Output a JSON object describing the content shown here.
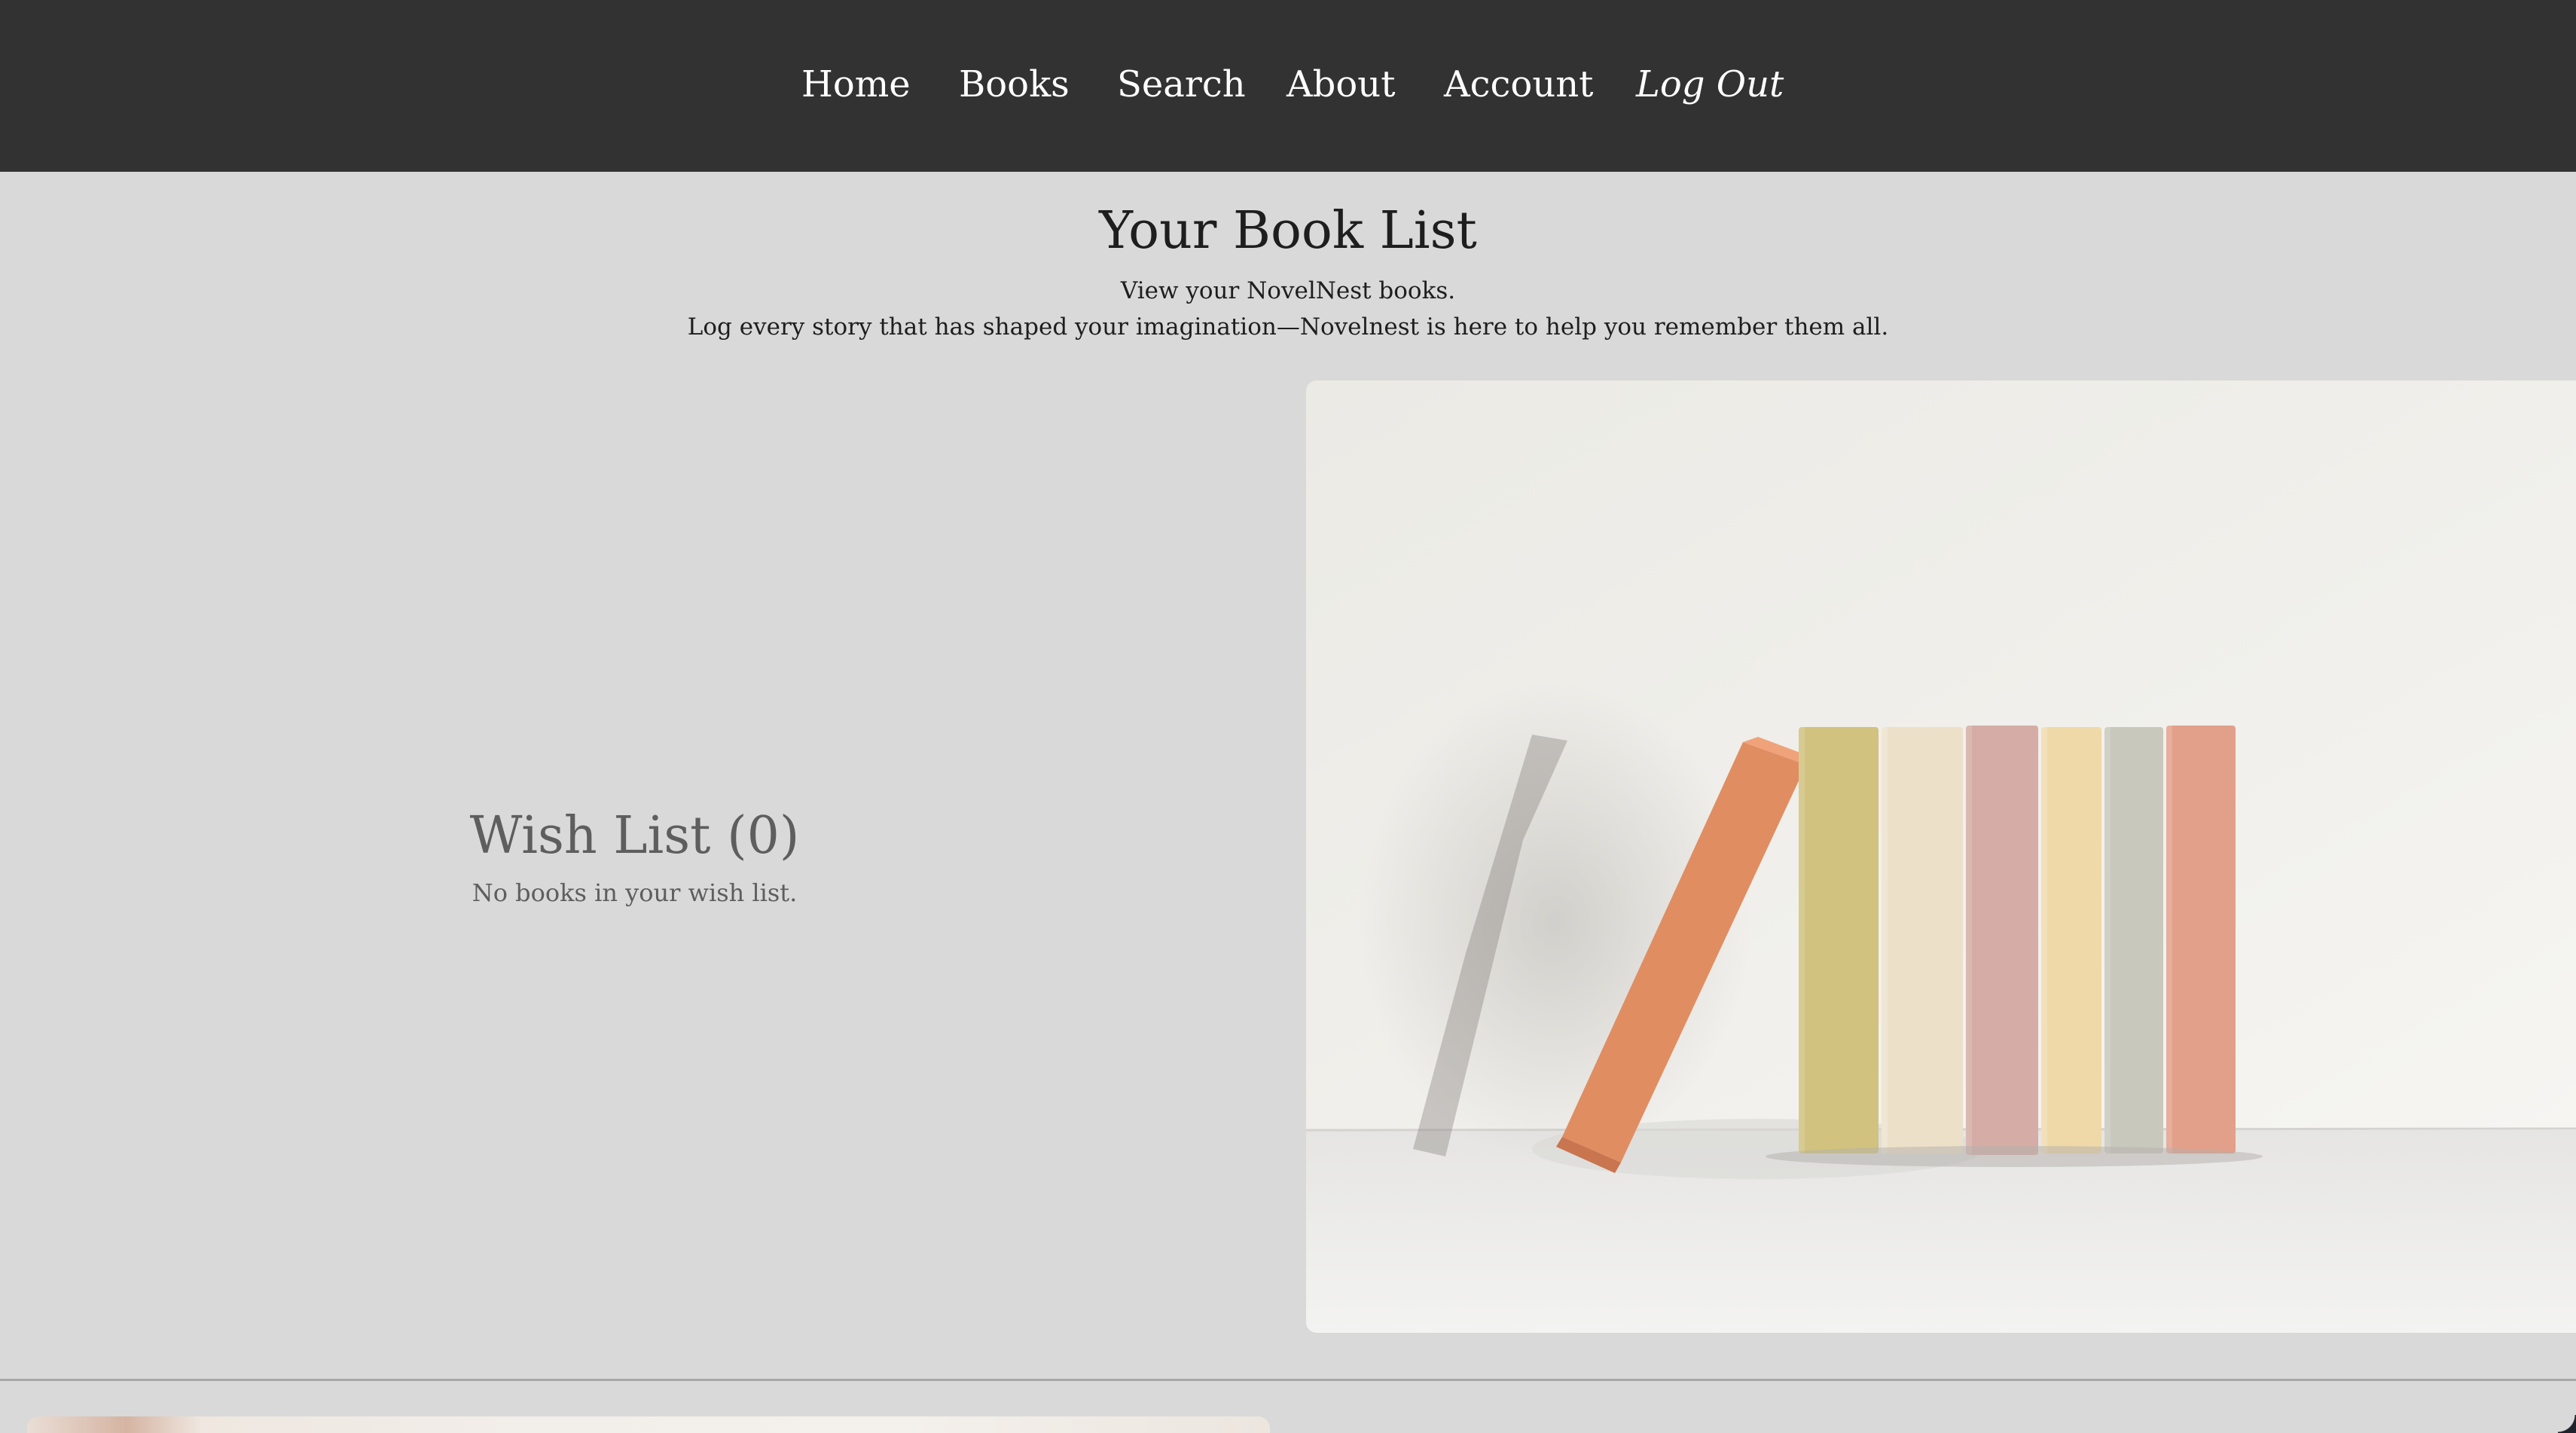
{
  "nav": {
    "items": [
      {
        "label": "Home"
      },
      {
        "label": "Books"
      },
      {
        "label": "Search"
      },
      {
        "label": "About"
      },
      {
        "label": "Account"
      },
      {
        "label": "Log Out"
      }
    ]
  },
  "header": {
    "title": "Your Book List",
    "subtitle_line1": "View your NovelNest books.",
    "subtitle_line2": "Log every story that has shaped your imagination—Novelnest is here to help you remember them all."
  },
  "wish_list": {
    "title": "Wish List (0)",
    "empty_message": "No books in your wish list."
  },
  "colors": {
    "navbar_bg": "#323232",
    "page_bg": "#d9d9d9",
    "heading_text": "#1e1e1e",
    "muted_text": "#5e5e5e"
  }
}
